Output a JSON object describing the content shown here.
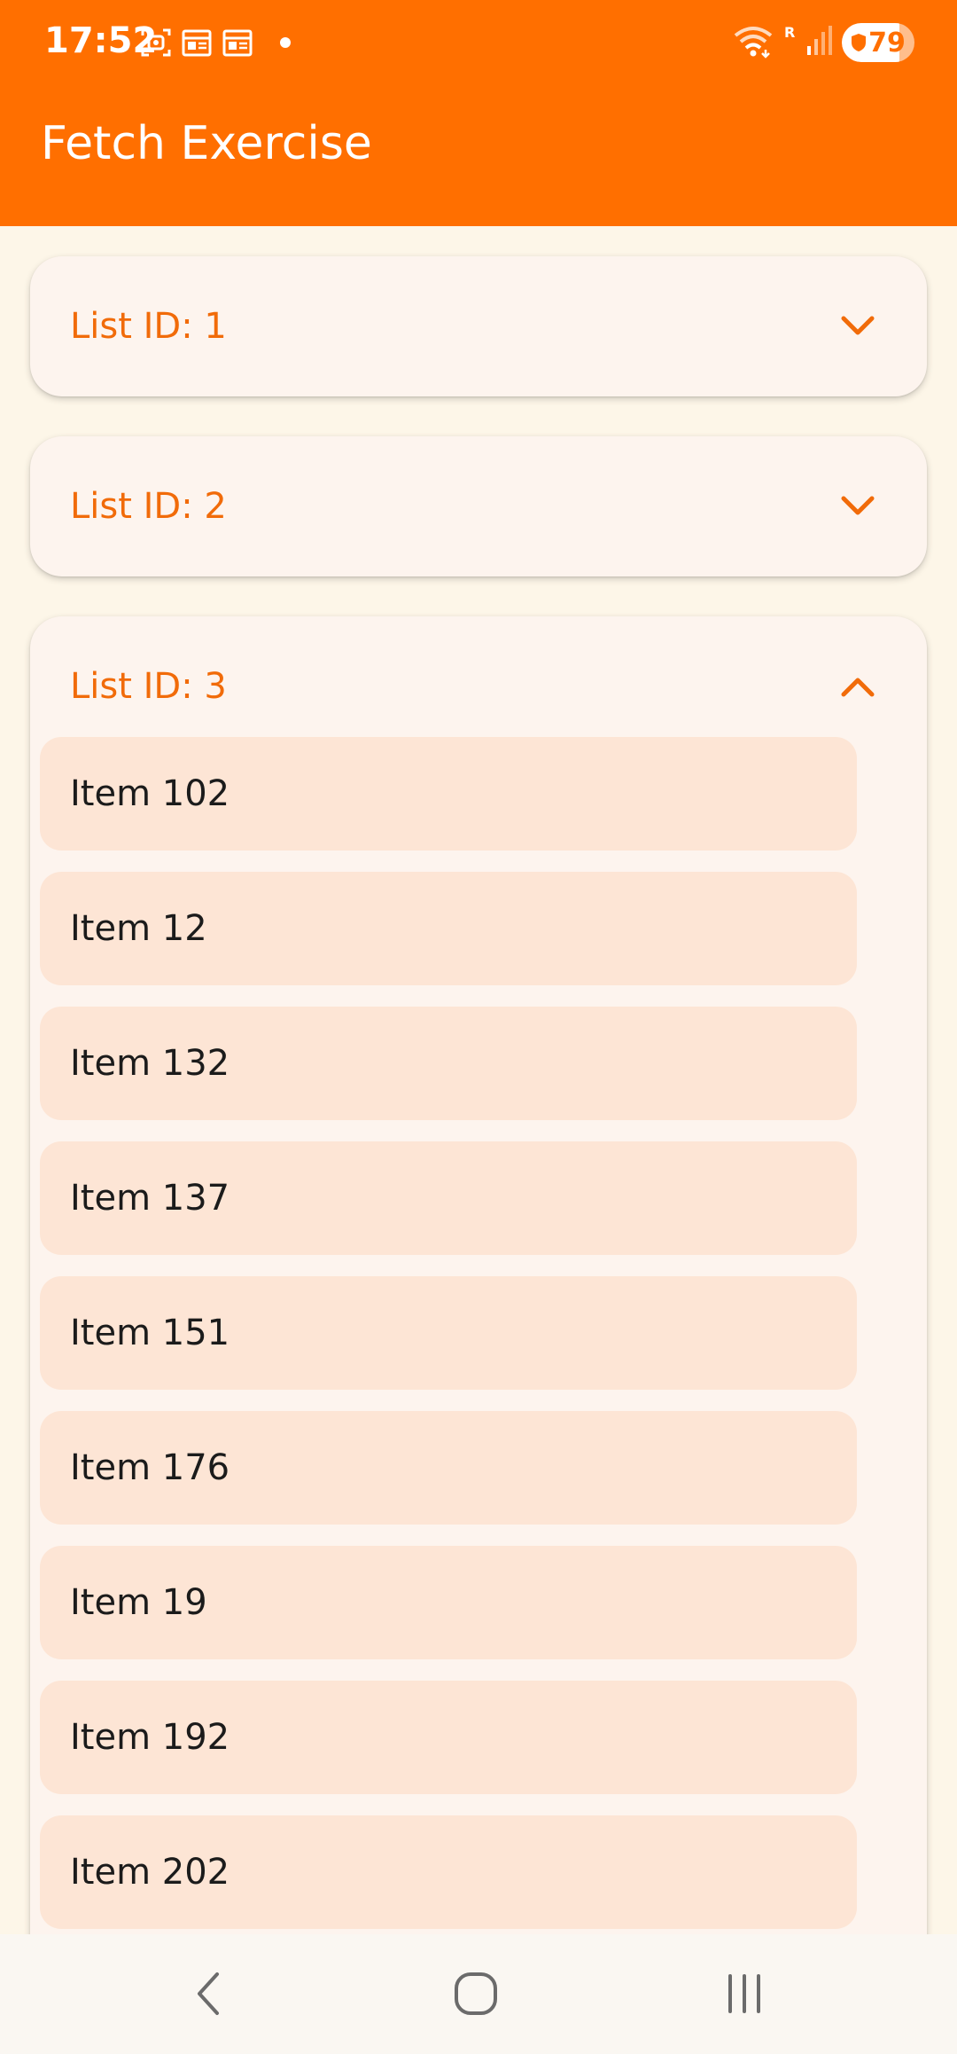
{
  "status_bar": {
    "time": "17:52",
    "battery": "79",
    "icons": [
      "screenshot-icon",
      "calendar-icon",
      "calendar-icon",
      "notification-dot-icon",
      "wifi-icon",
      "roaming-icon",
      "signal-icon",
      "battery-icon"
    ]
  },
  "app_bar": {
    "title": "Fetch Exercise"
  },
  "lists": [
    {
      "label": "List ID: 1",
      "expanded": false
    },
    {
      "label": "List ID: 2",
      "expanded": false
    },
    {
      "label": "List ID: 3",
      "expanded": true,
      "items": [
        "Item 102",
        "Item 12",
        "Item 132",
        "Item 137",
        "Item 151",
        "Item 176",
        "Item 19",
        "Item 192",
        "Item 202"
      ]
    }
  ],
  "nav_bar": {
    "buttons": [
      "back-icon",
      "home-icon",
      "recents-icon"
    ]
  },
  "colors": {
    "app_bar": "#FF6F00",
    "background": "#FDF6E8",
    "accent_text": "#F16B09",
    "card": "#FDF4EE",
    "item": "#FDE5D5"
  }
}
